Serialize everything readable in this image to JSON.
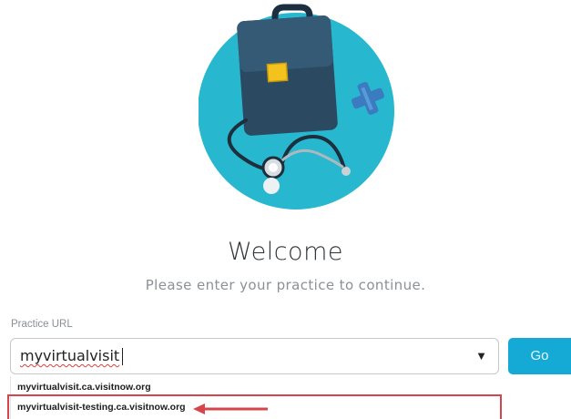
{
  "welcome": {
    "title": "Welcome",
    "subtitle": "Please enter your practice to continue."
  },
  "practice": {
    "label": "Practice URL",
    "value": "myvirtualvisit",
    "go_label": "Go",
    "options": [
      "myvirtualvisit.ca.visitnow.org",
      "myvirtualvisit-testing.ca.visitnow.org"
    ]
  },
  "icons": {
    "hero": "doctor-bag-stethoscope-illustration",
    "dropdown": "triangle-down-icon",
    "annotation": "red-arrow-left-icon"
  },
  "colors": {
    "hero_circle": "#27b8cf",
    "bag": "#2b4a62",
    "go_button": "#15a9d6",
    "highlight": "#d6454b"
  }
}
